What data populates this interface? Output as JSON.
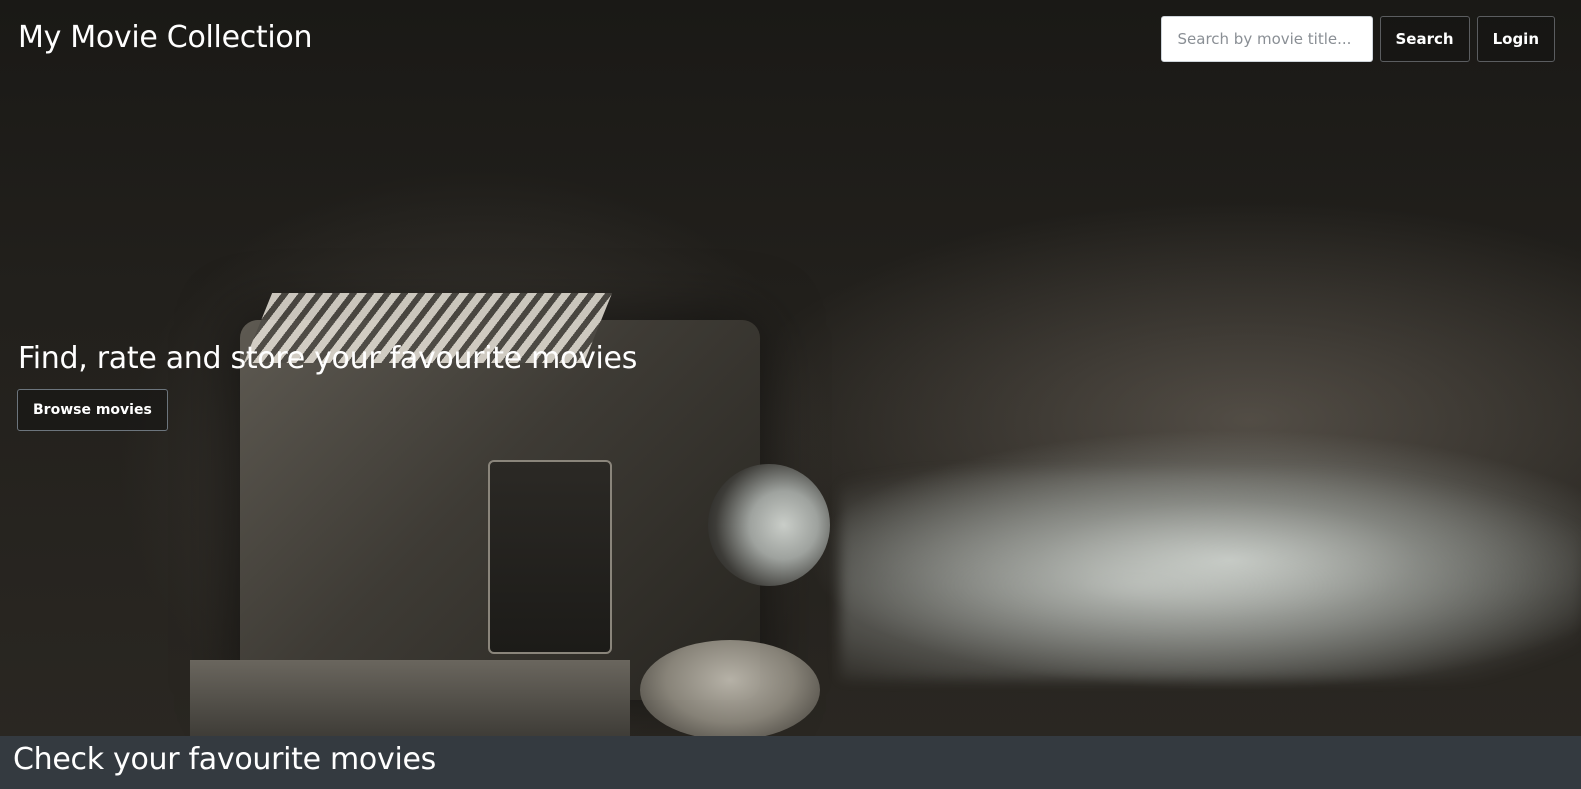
{
  "header": {
    "brand": "My Movie Collection",
    "search_placeholder": "Search by movie title...",
    "search_value": "",
    "search_button": "Search",
    "login_button": "Login"
  },
  "hero": {
    "tagline": "Find, rate and store your favourite movies",
    "browse_button": "Browse movies"
  },
  "section": {
    "title": "Check your favourite movies"
  },
  "colors": {
    "section_bar": "#343a40",
    "text": "#ffffff"
  },
  "icons": {
    "hero_image": "film-projector-photo"
  }
}
